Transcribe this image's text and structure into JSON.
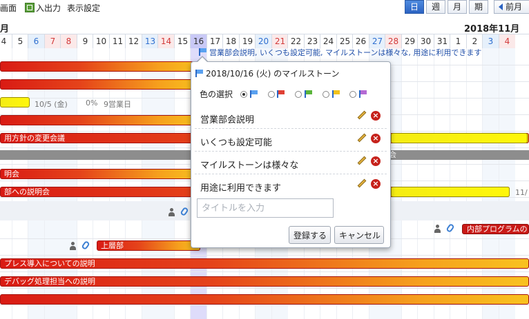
{
  "toolbar": {
    "screen_label": "画面",
    "io_label": "入出力",
    "display_settings_label": "表示設定",
    "view_day": "日",
    "view_week": "週",
    "view_month": "月",
    "view_period": "期",
    "prev_month": "前月"
  },
  "calendar": {
    "month_left": "月",
    "month_right": "2018年11月",
    "days": [
      {
        "d": "4",
        "t": ""
      },
      {
        "d": "5",
        "t": ""
      },
      {
        "d": "6",
        "t": "sat"
      },
      {
        "d": "7",
        "t": "sun"
      },
      {
        "d": "8",
        "t": "sun"
      },
      {
        "d": "9",
        "t": ""
      },
      {
        "d": "10",
        "t": ""
      },
      {
        "d": "11",
        "t": ""
      },
      {
        "d": "12",
        "t": ""
      },
      {
        "d": "13",
        "t": "sat"
      },
      {
        "d": "14",
        "t": "sun"
      },
      {
        "d": "15",
        "t": ""
      },
      {
        "d": "16",
        "t": "today"
      },
      {
        "d": "17",
        "t": ""
      },
      {
        "d": "18",
        "t": ""
      },
      {
        "d": "19",
        "t": ""
      },
      {
        "d": "20",
        "t": "sat"
      },
      {
        "d": "21",
        "t": "sun"
      },
      {
        "d": "22",
        "t": ""
      },
      {
        "d": "23",
        "t": ""
      },
      {
        "d": "24",
        "t": ""
      },
      {
        "d": "25",
        "t": ""
      },
      {
        "d": "26",
        "t": ""
      },
      {
        "d": "27",
        "t": "sat"
      },
      {
        "d": "28",
        "t": "sun"
      },
      {
        "d": "29",
        "t": ""
      },
      {
        "d": "30",
        "t": ""
      },
      {
        "d": "31",
        "t": ""
      },
      {
        "d": "1",
        "t": ""
      },
      {
        "d": "2",
        "t": ""
      },
      {
        "d": "3",
        "t": "sat"
      },
      {
        "d": "4",
        "t": "sun"
      }
    ]
  },
  "milestone_strip": "営業部会説明, いくつも設定可能, マイルストーンは様々な, 用途に利用できます",
  "tasks": {
    "row3_meta_date": "10/5 (金)",
    "row3_meta_pct": "0%",
    "row3_meta_days": "9営業日",
    "row5_label": "用方針の変更会議",
    "greyband_label": "会",
    "row7_label": "明会",
    "row8_label": "部への説明会",
    "row8_meta": "11/",
    "row10_label": "上層部",
    "row10_right_label": "内部プログラムの",
    "row11_label": "プレス導入についての説明",
    "row12_label": "デバッグ処理担当への説明"
  },
  "popup": {
    "title": "2018/10/16 (火) のマイルストーン",
    "color_label": "色の選択",
    "colors": [
      "blue",
      "red",
      "green",
      "yellow",
      "purple"
    ],
    "selected_color": "blue",
    "items": [
      {
        "label": "営業部会説明"
      },
      {
        "label": "いくつも設定可能"
      },
      {
        "label": "マイルストーンは様々な"
      },
      {
        "label": "用途に利用できます"
      }
    ],
    "input_placeholder": "タイトルを入力",
    "input_value": "",
    "register_label": "登録する",
    "cancel_label": "キャンセル"
  }
}
